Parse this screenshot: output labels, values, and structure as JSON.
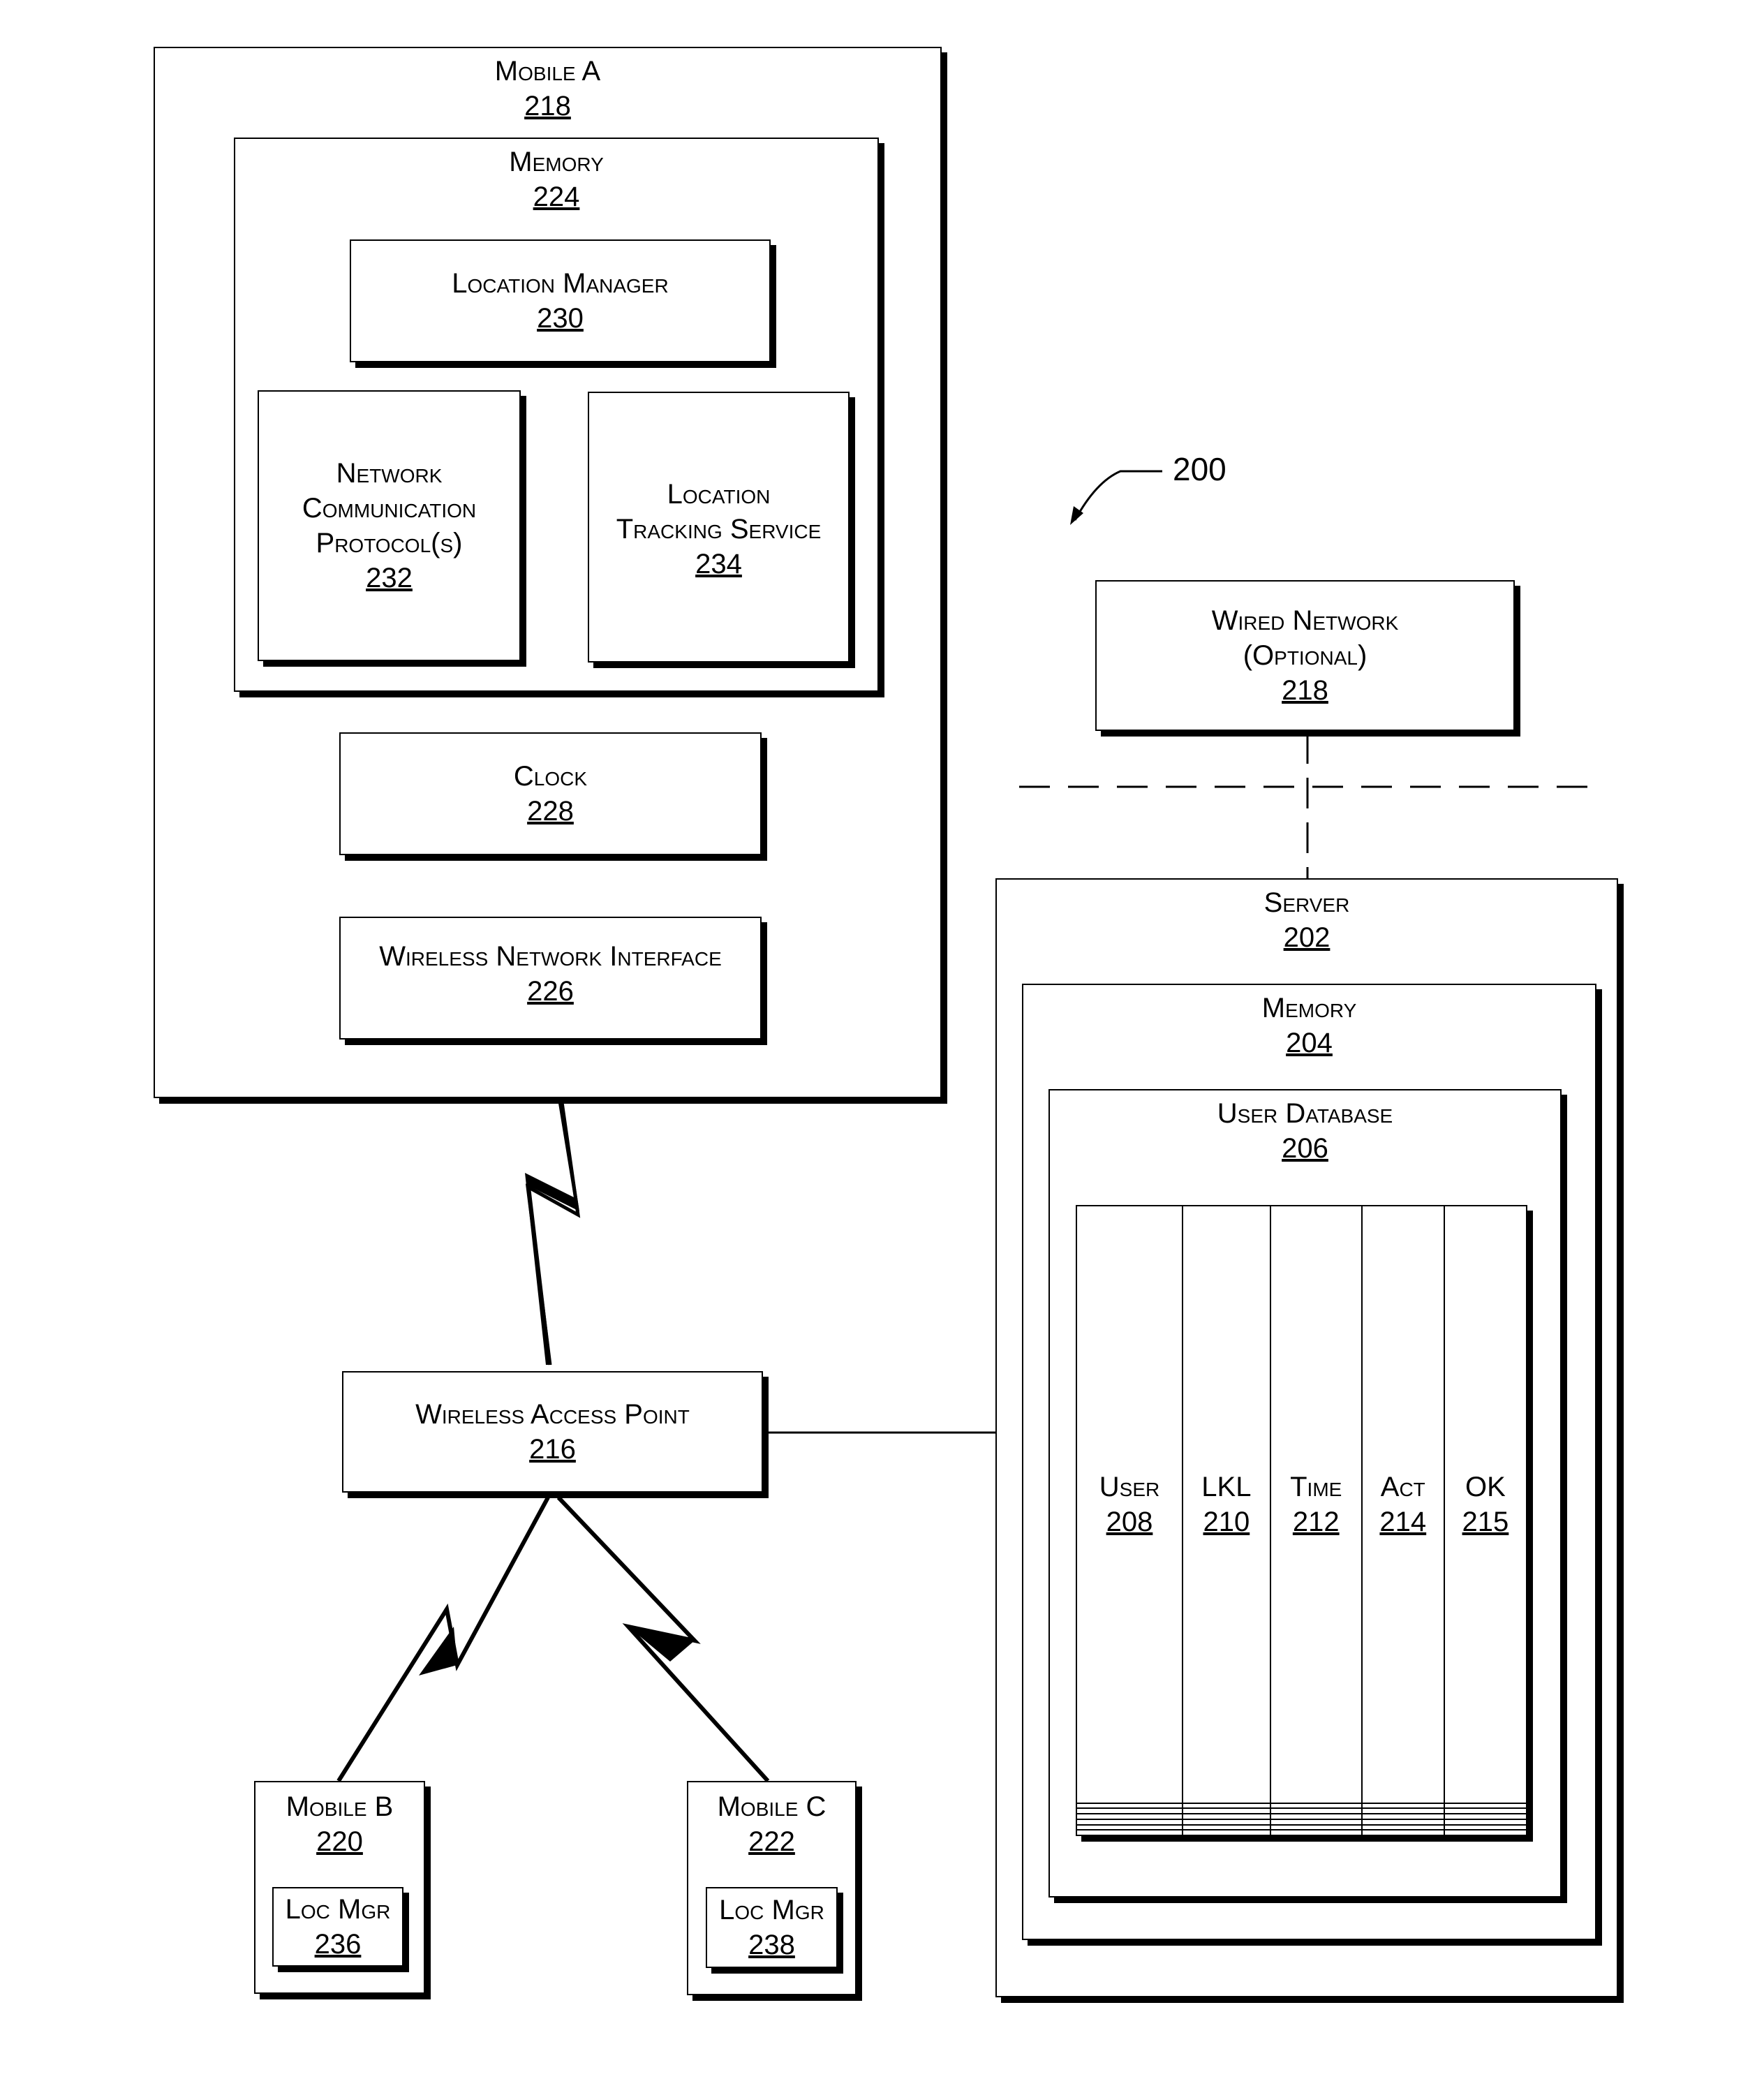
{
  "figure": {
    "reference": "200",
    "mobile_a": {
      "title": "Mobile A",
      "num": "218"
    },
    "memory_a": {
      "title": "Memory",
      "num": "224"
    },
    "location_manager": {
      "title": "Location Manager",
      "num": "230"
    },
    "network_comm": {
      "lines": [
        "Network",
        "Communication",
        "Protocol(s)"
      ],
      "num": "232"
    },
    "location_tracking": {
      "lines": [
        "Location",
        "Tracking Service"
      ],
      "num": "234"
    },
    "clock": {
      "title": "Clock",
      "num": "228"
    },
    "wireless_interface": {
      "title": "Wireless Network Interface",
      "num": "226"
    },
    "wired_network": {
      "lines": [
        "Wired Network",
        "(Optional)"
      ],
      "num": "218"
    },
    "server": {
      "title": "Server",
      "num": "202"
    },
    "memory_server": {
      "title": "Memory",
      "num": "204"
    },
    "user_database": {
      "title": "User Database",
      "num": "206"
    },
    "table": {
      "columns": [
        {
          "label": "User",
          "num": "208"
        },
        {
          "label": "LKL",
          "num": "210"
        },
        {
          "label": "Time",
          "num": "212"
        },
        {
          "label": "Act",
          "num": "214"
        },
        {
          "label": "OK",
          "num": "215"
        }
      ],
      "empty_rows": 6
    },
    "access_point": {
      "title": "Wireless Access Point",
      "num": "216"
    },
    "mobile_b": {
      "title": "Mobile B",
      "num": "220",
      "sub_title": "Loc Mgr",
      "sub_num": "236"
    },
    "mobile_c": {
      "title": "Mobile C",
      "num": "222",
      "sub_title": "Loc Mgr",
      "sub_num": "238"
    }
  }
}
